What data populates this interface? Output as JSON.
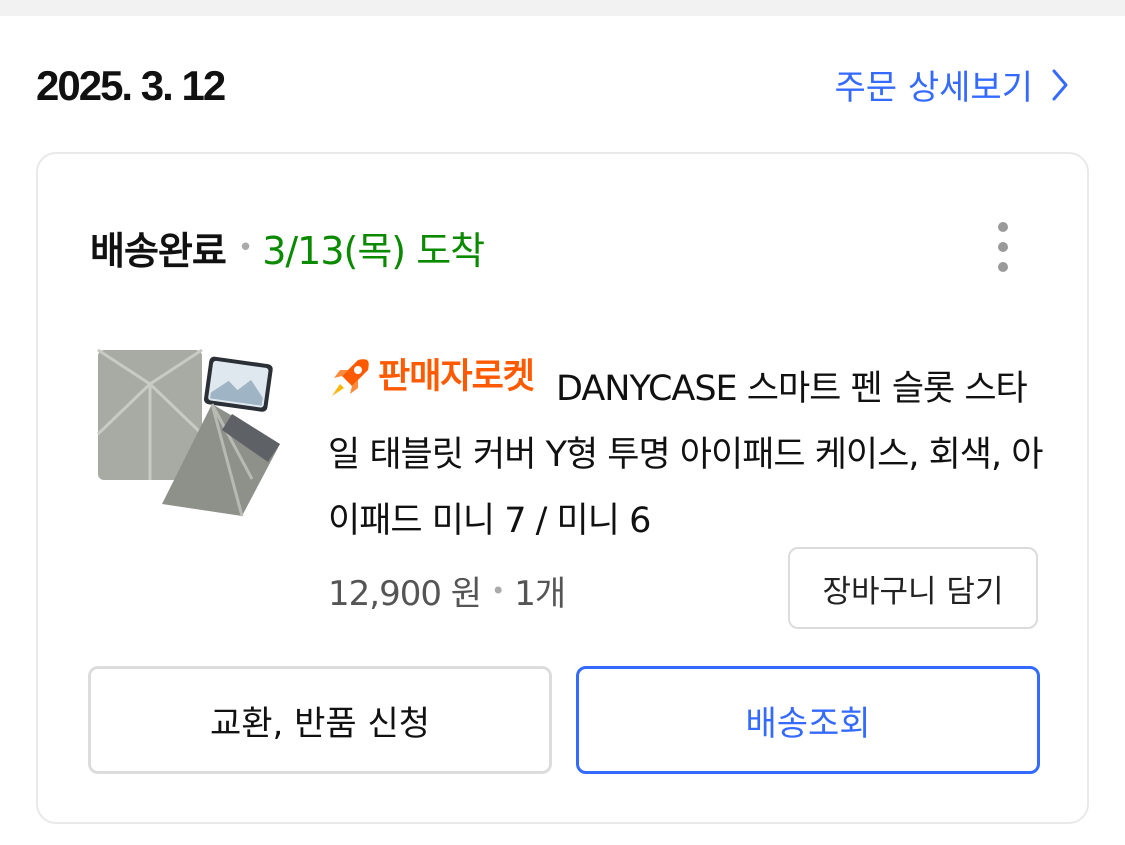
{
  "order": {
    "date": "2025. 3. 12",
    "detail_link_label": "주문 상세보기"
  },
  "shipment": {
    "status": "배송완료",
    "arrival": "3/13(목) 도착"
  },
  "product": {
    "badge_label": "판매자로켓",
    "title": "DANYCASE 스마트 펜 슬롯 스타일 태블릿 커버 Y형 투명 아이패드 케이스, 회색, 아이패드 미니 7 / 미니 6",
    "price": "12,900 원",
    "quantity": "1개"
  },
  "actions": {
    "cart_label": "장바구니 담기",
    "return_label": "교환, 반품 신청",
    "track_label": "배송조회"
  },
  "colors": {
    "accent": "#346aff",
    "arrival_green": "#0b8a00",
    "rocket_orange": "#ff5a00"
  },
  "icons": [
    "chevron-right-icon",
    "more-vertical-icon",
    "rocket-icon"
  ]
}
